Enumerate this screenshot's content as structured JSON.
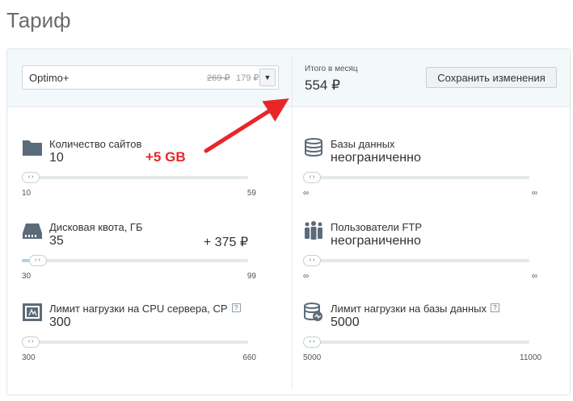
{
  "page_title": "Тариф",
  "plan": {
    "name": "Optimo+",
    "old_price": "269 ₽",
    "new_price": "179 ₽"
  },
  "total": {
    "label": "Итого в месяц",
    "value": "554 ₽"
  },
  "save_button": "Сохранить изменения",
  "annotation": "+5 GB",
  "params": {
    "sites": {
      "label": "Количество сайтов",
      "value": "10",
      "min": "10",
      "max": "59",
      "level": 0
    },
    "disk": {
      "label": "Дисковая квота, ГБ",
      "value": "35",
      "extra": "+ 375 ₽",
      "min": "30",
      "max": "99",
      "level": 0.07
    },
    "cpu": {
      "label": "Лимит нагрузки на CPU сервера, СР",
      "help": "?",
      "value": "300",
      "min": "300",
      "max": "660",
      "level": 0
    },
    "db": {
      "label": "Базы данных",
      "value": "неограниченно",
      "min": "∞",
      "max": "∞",
      "level": 0
    },
    "ftp": {
      "label": "Пользователи FTP",
      "value": "неограниченно",
      "min": "∞",
      "max": "∞",
      "level": 0
    },
    "dbload": {
      "label": "Лимит нагрузки на базы данных",
      "help": "?",
      "value": "5000",
      "min": "5000",
      "max": "11000",
      "level": 0
    }
  },
  "colors": {
    "accent": "#2a5f86",
    "icon": "#5b6b7a",
    "arrow": "#e8262a"
  }
}
